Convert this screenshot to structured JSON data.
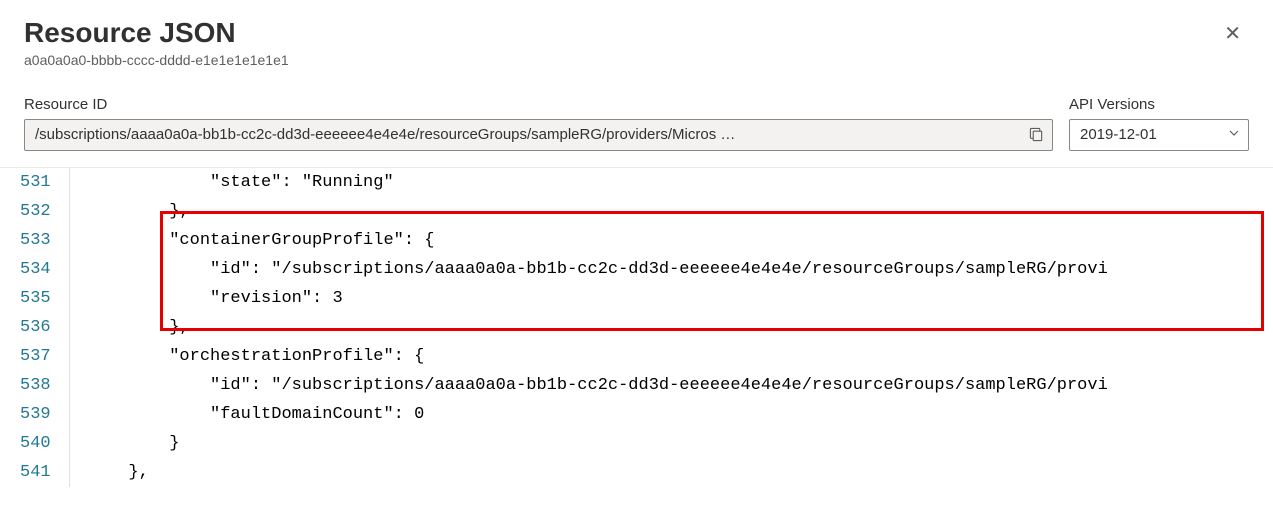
{
  "header": {
    "title": "Resource JSON",
    "subtitle": "a0a0a0a0-bbbb-cccc-dddd-e1e1e1e1e1e1"
  },
  "fields": {
    "resourceId": {
      "label": "Resource ID",
      "value": "/subscriptions/aaaa0a0a-bb1b-cc2c-dd3d-eeeeee4e4e4e/resourceGroups/sampleRG/providers/Micros …"
    },
    "apiVersions": {
      "label": "API Versions",
      "value": "2019-12-01"
    }
  },
  "code": {
    "startLine": 531,
    "lines": [
      "            \"state\": \"Running\"",
      "        },",
      "        \"containerGroupProfile\": {",
      "            \"id\": \"/subscriptions/aaaa0a0a-bb1b-cc2c-dd3d-eeeeee4e4e4e/resourceGroups/sampleRG/provi",
      "            \"revision\": 3",
      "        },",
      "        \"orchestrationProfile\": {",
      "            \"id\": \"/subscriptions/aaaa0a0a-bb1b-cc2c-dd3d-eeeeee4e4e4e/resourceGroups/sampleRG/provi",
      "            \"faultDomainCount\": 0",
      "        }",
      "    },"
    ]
  }
}
